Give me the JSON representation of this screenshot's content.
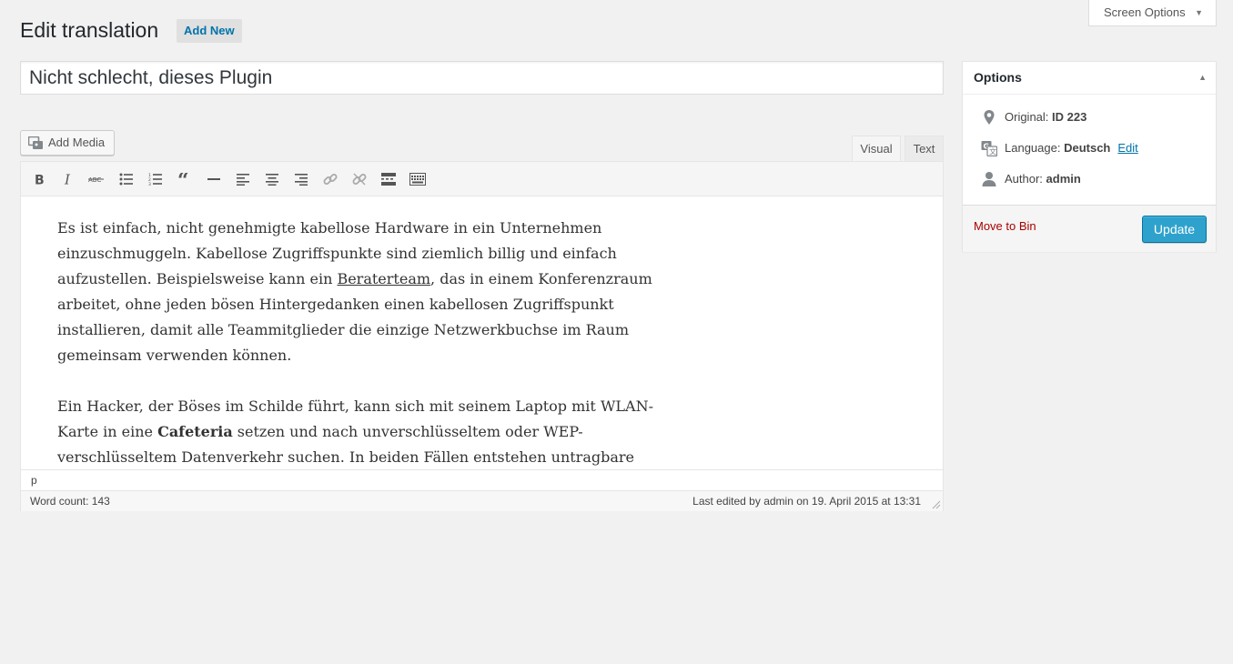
{
  "screen_options": {
    "label": "Screen Options",
    "caret": "▼"
  },
  "header": {
    "title": "Edit translation",
    "add_new_label": "Add New"
  },
  "post_title": "Nicht schlecht, dieses Plugin",
  "editor": {
    "add_media_label": "Add Media",
    "tabs": {
      "visual": "Visual",
      "text": "Text"
    },
    "toolbar_icons": [
      "bold-icon",
      "italic-icon",
      "strikethrough-icon",
      "bulleted-list-icon",
      "numbered-list-icon",
      "blockquote-icon",
      "horizontal-line-icon",
      "align-left-icon",
      "align-center-icon",
      "align-right-icon",
      "insert-link-icon",
      "remove-link-icon",
      "read-more-icon",
      "toolbar-toggle-icon"
    ],
    "paragraph1": {
      "part1": "Es ist einfach, nicht genehmigte kabellose Hardware in ein Unternehmen einzuschmuggeln. Kabellose Zugriffspunkte sind ziemlich billig und einfach aufzustellen. Beispielsweise kann ein ",
      "link": "Beraterteam",
      "part2": ", das in einem Konferenzraum arbeitet, ohne jeden bösen Hintergedanken einen kabellosen Zugriffspunkt installieren, damit alle Teammitglieder die einzige Netzwerkbuchse im Raum gemeinsam verwenden können."
    },
    "paragraph2": {
      "part1": "Ein Hacker, der Böses im Schilde führt, kann sich mit seinem Laptop mit WLAN-Karte in eine ",
      "bold": "Cafeteria",
      "part2": " setzen und nach unverschlüsseltem oder WEP-verschlüsseltem Datenverkehr suchen. In beiden Fällen entstehen untragbare"
    },
    "path": "p",
    "word_count": "Word count: 143",
    "last_edited": "Last edited by admin on 19. April 2015 at 13:31"
  },
  "options": {
    "title": "Options",
    "original_label": "Original:",
    "original_value": "ID 223",
    "language_label": "Language:",
    "language_value": "Deutsch",
    "edit_label": "Edit",
    "author_label": "Author:",
    "author_value": "admin",
    "move_to_bin": "Move to Bin",
    "update": "Update"
  },
  "colors": {
    "accent": "#2ea2cc",
    "link": "#0073aa",
    "danger": "#a00",
    "background": "#f1f1f1"
  }
}
